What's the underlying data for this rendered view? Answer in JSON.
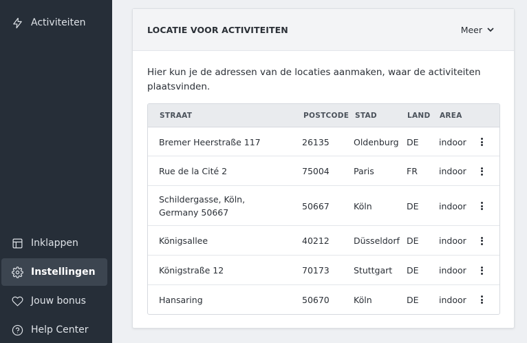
{
  "sidebar": {
    "top_item": {
      "label": "Activiteiten",
      "icon": "lightning-icon"
    },
    "bottom_items": [
      {
        "label": "Inklappen",
        "icon": "collapse-icon"
      },
      {
        "label": "Instellingen",
        "icon": "gear-icon",
        "active": true
      },
      {
        "label": "Jouw bonus",
        "icon": "heart-icon"
      },
      {
        "label": "Help Center",
        "icon": "help-icon"
      }
    ]
  },
  "card": {
    "title": "LOCATIE VOOR ACTIVITEITEN",
    "more_label": "Meer",
    "description": "Hier kun je de adressen van de locaties aanmaken, waar de activiteiten plaatsvinden."
  },
  "table": {
    "headers": [
      "STRAAT",
      "POSTCODE",
      "STAD",
      "LAND",
      "AREA"
    ],
    "rows": [
      {
        "street": "Bremer Heerstraße 117",
        "postcode": "26135",
        "city": "Oldenburg",
        "country": "DE",
        "area": "indoor"
      },
      {
        "street": "Rue de la Cité 2",
        "postcode": "75004",
        "city": "Paris",
        "country": "FR",
        "area": "indoor"
      },
      {
        "street": "Schildergasse, Köln, Germany 50667",
        "postcode": "50667",
        "city": "Köln",
        "country": "DE",
        "area": "indoor"
      },
      {
        "street": "Königsallee",
        "postcode": "40212",
        "city": "Düsseldorf",
        "country": "DE",
        "area": "indoor"
      },
      {
        "street": "Königstraße 12",
        "postcode": "70173",
        "city": "Stuttgart",
        "country": "DE",
        "area": "indoor"
      },
      {
        "street": "Hansaring",
        "postcode": "50670",
        "city": "Köln",
        "country": "DE",
        "area": "indoor"
      }
    ]
  }
}
